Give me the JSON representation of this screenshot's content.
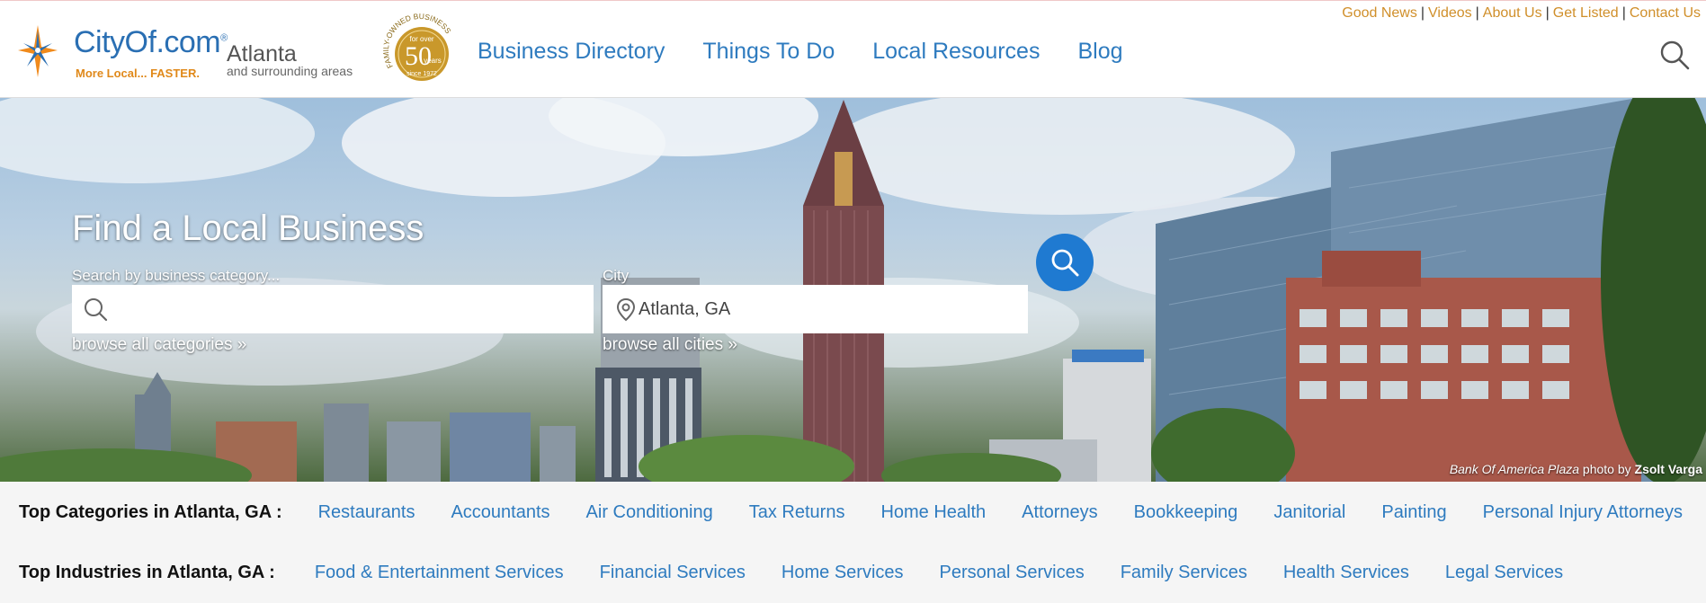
{
  "header": {
    "util_links": [
      "Good News",
      "Videos",
      "About Us",
      "Get Listed",
      "Contact Us"
    ],
    "logo_name": "CityOf.com",
    "logo_registered": "®",
    "logo_tagline": "More Local... FASTER.",
    "city": "Atlanta",
    "city_sub": "and surrounding areas",
    "badge": {
      "ring_text": "FAMILY-OWNED BUSINESS",
      "for_over": "for over",
      "number": "50",
      "years": "years",
      "since": "since 1972"
    },
    "nav": [
      "Business Directory",
      "Things To Do",
      "Local Resources",
      "Blog"
    ]
  },
  "hero": {
    "title": "Find a Local Business",
    "category_label": "Search by business category...",
    "category_value": "",
    "city_label": "City",
    "city_value": "Atlanta, GA",
    "browse_categories": "browse all categories »",
    "browse_cities": "browse all cities »",
    "credit_place": "Bank Of America Plaza",
    "credit_mid": "photo by",
    "credit_author": "Zsolt Varga"
  },
  "top_categories": {
    "label": "Top Categories in Atlanta, GA :",
    "items": [
      "Restaurants",
      "Accountants",
      "Air Conditioning",
      "Tax Returns",
      "Home Health",
      "Attorneys",
      "Bookkeeping",
      "Janitorial",
      "Painting",
      "Personal Injury Attorneys"
    ]
  },
  "top_industries": {
    "label": "Top Industries in Atlanta, GA :",
    "items": [
      "Food & Entertainment Services",
      "Financial Services",
      "Home Services",
      "Personal Services",
      "Family Services",
      "Health Services",
      "Legal Services"
    ]
  },
  "colors": {
    "nav_blue": "#2e7bbf",
    "util_orange": "#d08f2a",
    "search_button": "#1f7ad1",
    "badge_gold": "#c9982b"
  },
  "icons": [
    "logo-star-icon",
    "search-icon",
    "magnifier-icon",
    "location-pin-icon"
  ]
}
